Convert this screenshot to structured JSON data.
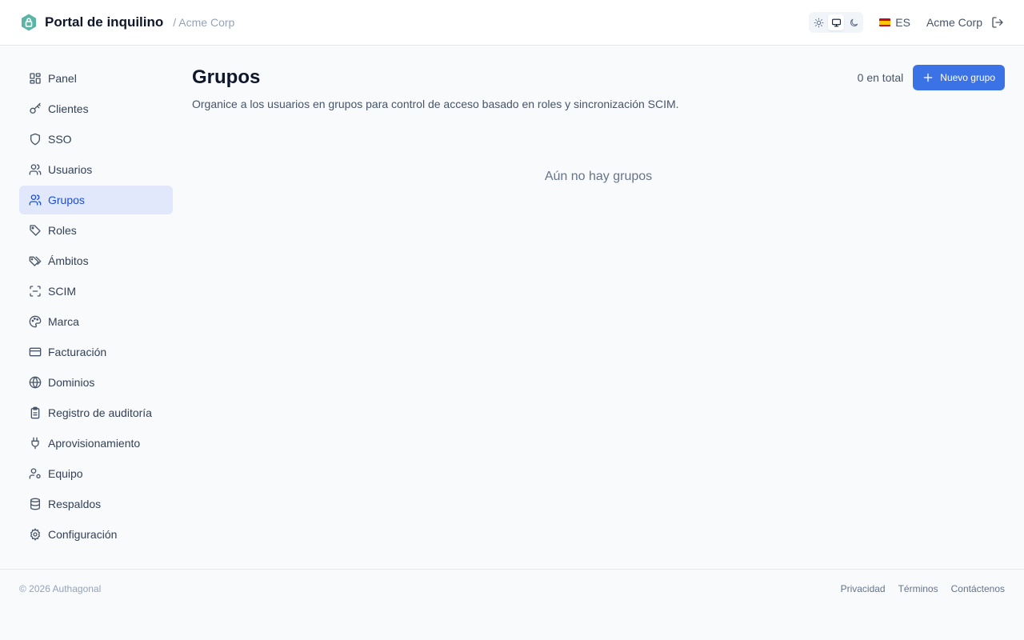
{
  "header": {
    "title": "Portal de inquilino",
    "breadcrumb": "/ Acme Corp",
    "theme_options": [
      "light",
      "system",
      "dark"
    ],
    "theme_active": "system",
    "language": "ES",
    "org_name": "Acme Corp",
    "logo_color": "#5bb5a6"
  },
  "sidebar": {
    "items": [
      {
        "label": "Panel",
        "icon": "dashboard-icon"
      },
      {
        "label": "Clientes",
        "icon": "key-icon"
      },
      {
        "label": "SSO",
        "icon": "shield-icon"
      },
      {
        "label": "Usuarios",
        "icon": "users-icon"
      },
      {
        "label": "Grupos",
        "icon": "users-icon",
        "active": true
      },
      {
        "label": "Roles",
        "icon": "tag-icon"
      },
      {
        "label": "Ámbitos",
        "icon": "tags-icon"
      },
      {
        "label": "SCIM",
        "icon": "scan-icon"
      },
      {
        "label": "Marca",
        "icon": "palette-icon"
      },
      {
        "label": "Facturación",
        "icon": "credit-card-icon"
      },
      {
        "label": "Dominios",
        "icon": "globe-icon"
      },
      {
        "label": "Registro de auditoría",
        "icon": "clipboard-icon"
      },
      {
        "label": "Aprovisionamiento",
        "icon": "plug-icon"
      },
      {
        "label": "Equipo",
        "icon": "user-cog-icon"
      },
      {
        "label": "Respaldos",
        "icon": "database-icon"
      },
      {
        "label": "Configuración",
        "icon": "gear-icon"
      }
    ]
  },
  "main": {
    "title": "Grupos",
    "subtitle": "Organice a los usuarios en grupos para control de acceso basado en roles y sincronización SCIM.",
    "count_label": "0 en total",
    "new_button": "Nuevo grupo",
    "empty_message": "Aún no hay grupos",
    "accent_color": "#3b73e6"
  },
  "footer": {
    "copyright": "© 2026 Authagonal",
    "links": [
      "Privacidad",
      "Términos",
      "Contáctenos"
    ]
  }
}
